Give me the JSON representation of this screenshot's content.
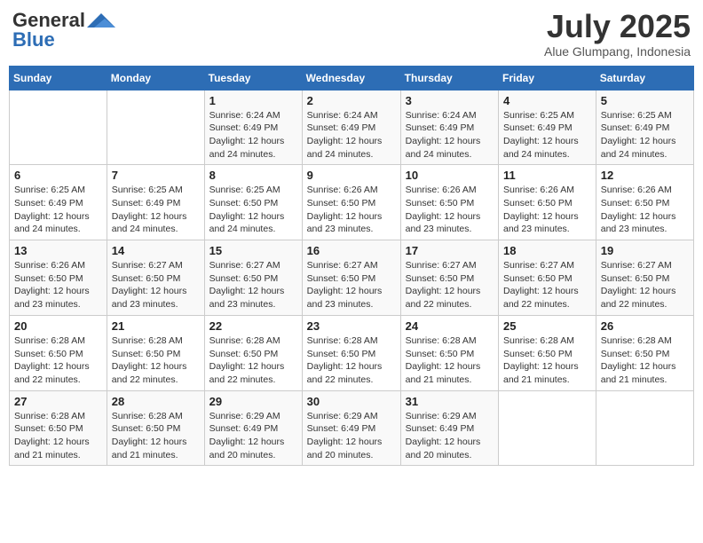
{
  "header": {
    "logo_general": "General",
    "logo_blue": "Blue",
    "month": "July 2025",
    "location": "Alue Glumpang, Indonesia"
  },
  "weekdays": [
    "Sunday",
    "Monday",
    "Tuesday",
    "Wednesday",
    "Thursday",
    "Friday",
    "Saturday"
  ],
  "weeks": [
    [
      {
        "day": "",
        "info": ""
      },
      {
        "day": "",
        "info": ""
      },
      {
        "day": "1",
        "info": "Sunrise: 6:24 AM\nSunset: 6:49 PM\nDaylight: 12 hours and 24 minutes."
      },
      {
        "day": "2",
        "info": "Sunrise: 6:24 AM\nSunset: 6:49 PM\nDaylight: 12 hours and 24 minutes."
      },
      {
        "day": "3",
        "info": "Sunrise: 6:24 AM\nSunset: 6:49 PM\nDaylight: 12 hours and 24 minutes."
      },
      {
        "day": "4",
        "info": "Sunrise: 6:25 AM\nSunset: 6:49 PM\nDaylight: 12 hours and 24 minutes."
      },
      {
        "day": "5",
        "info": "Sunrise: 6:25 AM\nSunset: 6:49 PM\nDaylight: 12 hours and 24 minutes."
      }
    ],
    [
      {
        "day": "6",
        "info": "Sunrise: 6:25 AM\nSunset: 6:49 PM\nDaylight: 12 hours and 24 minutes."
      },
      {
        "day": "7",
        "info": "Sunrise: 6:25 AM\nSunset: 6:49 PM\nDaylight: 12 hours and 24 minutes."
      },
      {
        "day": "8",
        "info": "Sunrise: 6:25 AM\nSunset: 6:50 PM\nDaylight: 12 hours and 24 minutes."
      },
      {
        "day": "9",
        "info": "Sunrise: 6:26 AM\nSunset: 6:50 PM\nDaylight: 12 hours and 23 minutes."
      },
      {
        "day": "10",
        "info": "Sunrise: 6:26 AM\nSunset: 6:50 PM\nDaylight: 12 hours and 23 minutes."
      },
      {
        "day": "11",
        "info": "Sunrise: 6:26 AM\nSunset: 6:50 PM\nDaylight: 12 hours and 23 minutes."
      },
      {
        "day": "12",
        "info": "Sunrise: 6:26 AM\nSunset: 6:50 PM\nDaylight: 12 hours and 23 minutes."
      }
    ],
    [
      {
        "day": "13",
        "info": "Sunrise: 6:26 AM\nSunset: 6:50 PM\nDaylight: 12 hours and 23 minutes."
      },
      {
        "day": "14",
        "info": "Sunrise: 6:27 AM\nSunset: 6:50 PM\nDaylight: 12 hours and 23 minutes."
      },
      {
        "day": "15",
        "info": "Sunrise: 6:27 AM\nSunset: 6:50 PM\nDaylight: 12 hours and 23 minutes."
      },
      {
        "day": "16",
        "info": "Sunrise: 6:27 AM\nSunset: 6:50 PM\nDaylight: 12 hours and 23 minutes."
      },
      {
        "day": "17",
        "info": "Sunrise: 6:27 AM\nSunset: 6:50 PM\nDaylight: 12 hours and 22 minutes."
      },
      {
        "day": "18",
        "info": "Sunrise: 6:27 AM\nSunset: 6:50 PM\nDaylight: 12 hours and 22 minutes."
      },
      {
        "day": "19",
        "info": "Sunrise: 6:27 AM\nSunset: 6:50 PM\nDaylight: 12 hours and 22 minutes."
      }
    ],
    [
      {
        "day": "20",
        "info": "Sunrise: 6:28 AM\nSunset: 6:50 PM\nDaylight: 12 hours and 22 minutes."
      },
      {
        "day": "21",
        "info": "Sunrise: 6:28 AM\nSunset: 6:50 PM\nDaylight: 12 hours and 22 minutes."
      },
      {
        "day": "22",
        "info": "Sunrise: 6:28 AM\nSunset: 6:50 PM\nDaylight: 12 hours and 22 minutes."
      },
      {
        "day": "23",
        "info": "Sunrise: 6:28 AM\nSunset: 6:50 PM\nDaylight: 12 hours and 22 minutes."
      },
      {
        "day": "24",
        "info": "Sunrise: 6:28 AM\nSunset: 6:50 PM\nDaylight: 12 hours and 21 minutes."
      },
      {
        "day": "25",
        "info": "Sunrise: 6:28 AM\nSunset: 6:50 PM\nDaylight: 12 hours and 21 minutes."
      },
      {
        "day": "26",
        "info": "Sunrise: 6:28 AM\nSunset: 6:50 PM\nDaylight: 12 hours and 21 minutes."
      }
    ],
    [
      {
        "day": "27",
        "info": "Sunrise: 6:28 AM\nSunset: 6:50 PM\nDaylight: 12 hours and 21 minutes."
      },
      {
        "day": "28",
        "info": "Sunrise: 6:28 AM\nSunset: 6:50 PM\nDaylight: 12 hours and 21 minutes."
      },
      {
        "day": "29",
        "info": "Sunrise: 6:29 AM\nSunset: 6:49 PM\nDaylight: 12 hours and 20 minutes."
      },
      {
        "day": "30",
        "info": "Sunrise: 6:29 AM\nSunset: 6:49 PM\nDaylight: 12 hours and 20 minutes."
      },
      {
        "day": "31",
        "info": "Sunrise: 6:29 AM\nSunset: 6:49 PM\nDaylight: 12 hours and 20 minutes."
      },
      {
        "day": "",
        "info": ""
      },
      {
        "day": "",
        "info": ""
      }
    ]
  ]
}
